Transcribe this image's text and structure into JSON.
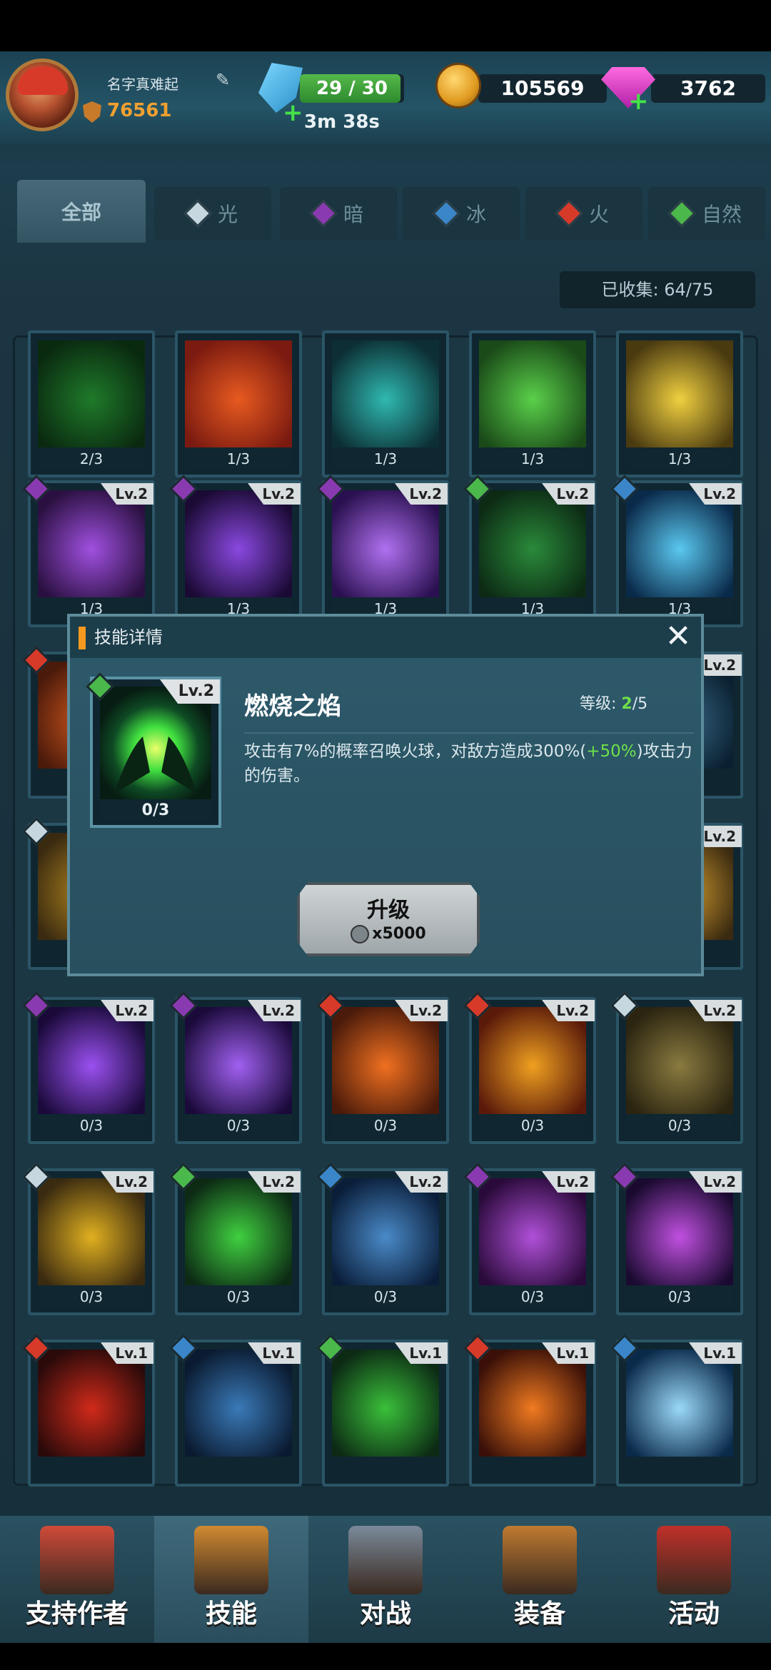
{
  "player": {
    "name": "名字真难起",
    "power": "76561"
  },
  "resources": {
    "energy": {
      "value": "29 / 30",
      "fraction": 0.967,
      "timer": "3m 38s"
    },
    "coins": "105569",
    "gems": "3762"
  },
  "tabs": [
    {
      "label": "全部",
      "color": "#5b7d8c"
    },
    {
      "label": "光",
      "color": "#c7d7e0"
    },
    {
      "label": "暗",
      "color": "#8a3ab0"
    },
    {
      "label": "冰",
      "color": "#3a86c8"
    },
    {
      "label": "火",
      "color": "#d83a2a"
    },
    {
      "label": "自然",
      "color": "#4bb84b"
    }
  ],
  "collected": "已收集: 64/75",
  "cards": [
    {
      "count": "2/3",
      "level": "",
      "element": "",
      "c1": "#1f7a2a",
      "c2": "#0a2a10"
    },
    {
      "count": "1/3",
      "level": "",
      "element": "",
      "c1": "#e85a20",
      "c2": "#7a1a10"
    },
    {
      "count": "1/3",
      "level": "",
      "element": "",
      "c1": "#2fb9b0",
      "c2": "#0c2e34"
    },
    {
      "count": "1/3",
      "level": "",
      "element": "",
      "c1": "#5ad04a",
      "c2": "#1a4a18"
    },
    {
      "count": "1/3",
      "level": "",
      "element": "",
      "c1": "#f0d040",
      "c2": "#4a3a10"
    },
    {
      "count": "1/3",
      "level": "Lv.2",
      "element": "dark",
      "c1": "#a050e0",
      "c2": "#2a1040"
    },
    {
      "count": "1/3",
      "level": "Lv.2",
      "element": "dark",
      "c1": "#8a48e0",
      "c2": "#1a0a34"
    },
    {
      "count": "1/3",
      "level": "Lv.2",
      "element": "dark",
      "c1": "#b070f0",
      "c2": "#2a1050"
    },
    {
      "count": "1/3",
      "level": "Lv.2",
      "element": "nature",
      "c1": "#2a8a3a",
      "c2": "#0c2a14"
    },
    {
      "count": "1/3",
      "level": "Lv.2",
      "element": "ice",
      "c1": "#5ac8f0",
      "c2": "#0a2a4a"
    },
    {
      "count": "",
      "level": "",
      "element": "fire",
      "c1": "#d85a20",
      "c2": "#4a1a0a"
    },
    {
      "count": "",
      "level": "",
      "element": "",
      "c1": "#1f3b48",
      "c2": "#1f3b48"
    },
    {
      "count": "",
      "level": "",
      "element": "",
      "c1": "#1f3b48",
      "c2": "#1f3b48"
    },
    {
      "count": "",
      "level": "",
      "element": "",
      "c1": "#1f3b48",
      "c2": "#1f3b48"
    },
    {
      "count": "",
      "level": "Lv.2",
      "element": "",
      "c1": "#3a6a88",
      "c2": "#0a2030"
    },
    {
      "count": "",
      "level": "",
      "element": "light",
      "c1": "#b88a20",
      "c2": "#3a2a10"
    },
    {
      "count": "",
      "level": "",
      "element": "",
      "c1": "#1f3b48",
      "c2": "#1f3b48"
    },
    {
      "count": "",
      "level": "",
      "element": "",
      "c1": "#1f3b48",
      "c2": "#1f3b48"
    },
    {
      "count": "",
      "level": "",
      "element": "",
      "c1": "#1f3b48",
      "c2": "#1f3b48"
    },
    {
      "count": "",
      "level": "Lv.2",
      "element": "",
      "c1": "#d8a030",
      "c2": "#3a2a10"
    },
    {
      "count": "0/3",
      "level": "Lv.2",
      "element": "dark",
      "c1": "#9a50f0",
      "c2": "#1a0a3a"
    },
    {
      "count": "0/3",
      "level": "Lv.2",
      "element": "dark",
      "c1": "#a060f0",
      "c2": "#1a0a3a"
    },
    {
      "count": "0/3",
      "level": "Lv.2",
      "element": "fire",
      "c1": "#f07020",
      "c2": "#4a1a0a"
    },
    {
      "count": "0/3",
      "level": "Lv.2",
      "element": "fire",
      "c1": "#f0a020",
      "c2": "#5a1a0a"
    },
    {
      "count": "0/3",
      "level": "Lv.2",
      "element": "light",
      "c1": "#8a7a40",
      "c2": "#2a2410"
    },
    {
      "count": "0/3",
      "level": "Lv.2",
      "element": "light",
      "c1": "#e0b020",
      "c2": "#3a2a10"
    },
    {
      "count": "0/3",
      "level": "Lv.2",
      "element": "nature",
      "c1": "#40d040",
      "c2": "#0c2a14"
    },
    {
      "count": "0/3",
      "level": "Lv.2",
      "element": "ice",
      "c1": "#4a8ac8",
      "c2": "#0a1e3a"
    },
    {
      "count": "0/3",
      "level": "Lv.2",
      "element": "dark",
      "c1": "#b050d8",
      "c2": "#2a0a3a"
    },
    {
      "count": "0/3",
      "level": "Lv.2",
      "element": "dark",
      "c1": "#c050e0",
      "c2": "#1a0a30"
    },
    {
      "count": "",
      "level": "Lv.1",
      "element": "fire",
      "c1": "#d02a1a",
      "c2": "#2a0a0a"
    },
    {
      "count": "",
      "level": "Lv.1",
      "element": "ice",
      "c1": "#3a7ab8",
      "c2": "#0a1a30"
    },
    {
      "count": "",
      "level": "Lv.1",
      "element": "nature",
      "c1": "#3ac03a",
      "c2": "#0c2a14"
    },
    {
      "count": "",
      "level": "Lv.1",
      "element": "fire",
      "c1": "#f07a20",
      "c2": "#3a1008"
    },
    {
      "count": "",
      "level": "Lv.1",
      "element": "ice",
      "c1": "#9ad8f8",
      "c2": "#0a2a4a"
    }
  ],
  "element_colors": {
    "dark": "#8a3ab0",
    "fire": "#d83a2a",
    "ice": "#3a86c8",
    "nature": "#4bb84b",
    "light": "#c7d7e0"
  },
  "modal": {
    "header": "技能详情",
    "close_icon": "close-icon",
    "card": {
      "level": "Lv.2",
      "count": "0/3"
    },
    "skill_name": "燃烧之焰",
    "level_label": "等级:",
    "level_current": "2",
    "level_max": "/5",
    "desc_part1": "攻击有7%的概率召唤火球，对敌方造成300%(",
    "desc_bonus": "+50%",
    "desc_part2": ")攻击力的伤害。",
    "upgrade_label": "升级",
    "upgrade_cost": "x5000"
  },
  "nav": [
    {
      "label": "支持作者",
      "icon": "shop-icon",
      "color": "#d04a3a"
    },
    {
      "label": "技能",
      "icon": "skill-book-icon",
      "color": "#d08a30"
    },
    {
      "label": "对战",
      "icon": "crossed-swords-icon",
      "color": "#7a8a9a"
    },
    {
      "label": "装备",
      "icon": "backpack-icon",
      "color": "#c07a30"
    },
    {
      "label": "活动",
      "icon": "event-badge-icon",
      "color": "#c0302a"
    }
  ]
}
